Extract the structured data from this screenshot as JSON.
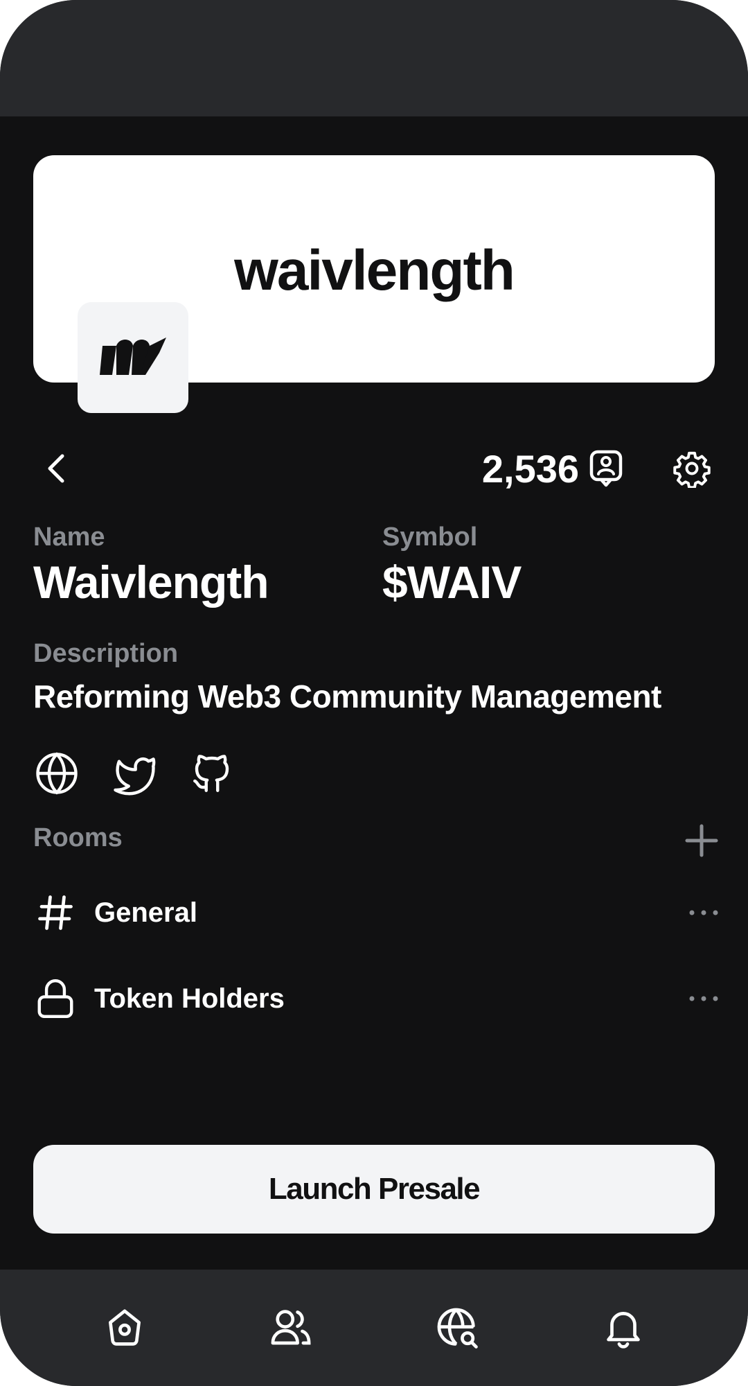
{
  "banner": {
    "title": "waivlength"
  },
  "header": {
    "member_count": "2,536"
  },
  "token": {
    "name_label": "Name",
    "name_value": "Waivlength",
    "symbol_label": "Symbol",
    "symbol_value": "$WAIV",
    "description_label": "Description",
    "description_value": "Reforming Web3 Community Management"
  },
  "socials": [
    "globe-icon",
    "twitter-icon",
    "github-icon"
  ],
  "rooms": {
    "label": "Rooms",
    "items": [
      {
        "name": "General",
        "icon": "hash-icon"
      },
      {
        "name": "Token Holders",
        "icon": "lock-icon"
      }
    ]
  },
  "actions": {
    "launch_label": "Launch Presale"
  },
  "nav": [
    "home-icon",
    "users-icon",
    "globe-search-icon",
    "bell-icon"
  ],
  "colors": {
    "background": "#111112",
    "bars": "#28292c",
    "muted_text": "#8a8d92",
    "text": "#ffffff",
    "button": "#f3f4f6"
  }
}
